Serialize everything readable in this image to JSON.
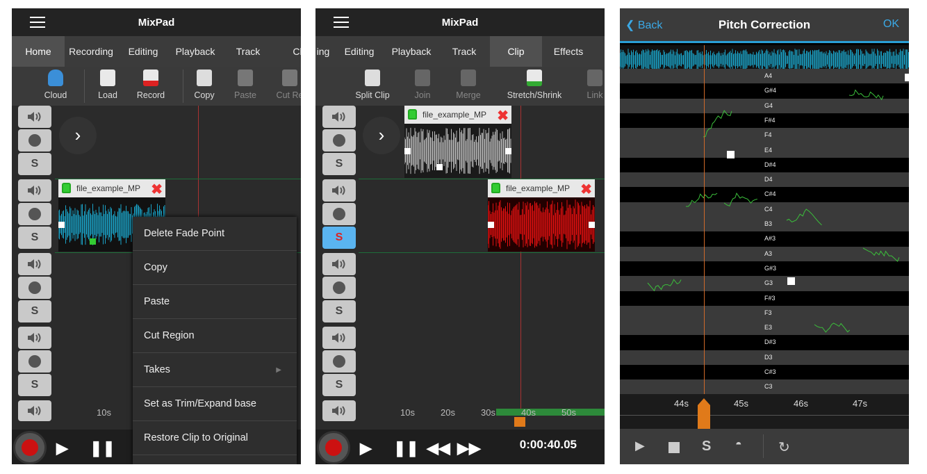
{
  "app_title": "MixPad",
  "panel1": {
    "tabs": [
      "Home",
      "Recording",
      "Editing",
      "Playback",
      "Track",
      "Cl"
    ],
    "tools": [
      "Cloud",
      "Load",
      "Record",
      "Copy",
      "Paste",
      "Cut Re"
    ],
    "clip_name": "file_example_MP",
    "ruler_label": "10s",
    "context_menu": [
      "Delete Fade Point",
      "Copy",
      "Paste",
      "Cut Region",
      "Takes",
      "Set as Trim/Expand base",
      "Restore Clip to Original"
    ],
    "solo_label": "S"
  },
  "panel2": {
    "tabs": [
      "ing",
      "Editing",
      "Playback",
      "Track",
      "Clip",
      "Effects"
    ],
    "active_tab": "Clip",
    "tools": [
      "Split Clip",
      "Join",
      "Merge",
      "Stretch/Shrink",
      "Link"
    ],
    "clip1_name": "file_example_MP",
    "clip2_name": "file_example_MP",
    "ruler_labels": [
      "10s",
      "20s",
      "30s",
      "40s",
      "50s"
    ],
    "time": "0:00:40.05",
    "solo_label": "S"
  },
  "panel3": {
    "back_label": "Back",
    "title": "Pitch Correction",
    "ok_label": "OK",
    "notes": [
      "A4",
      "G#4",
      "G4",
      "F#4",
      "F4",
      "E4",
      "D#4",
      "D4",
      "C#4",
      "C4",
      "B3",
      "A#3",
      "A3",
      "G#3",
      "G3",
      "F#3",
      "F3",
      "E3",
      "D#3",
      "D3",
      "C#3",
      "C3"
    ],
    "ruler_labels": [
      "44s",
      "45s",
      "46s",
      "47s"
    ],
    "solo_label": "S"
  },
  "colors": {
    "accent": "#2a9fd6",
    "solo_active": "#5ab4f0",
    "clip_red": "#e01010",
    "clip_teal": "#1aa3c8",
    "playhead": "#d06a2a"
  }
}
